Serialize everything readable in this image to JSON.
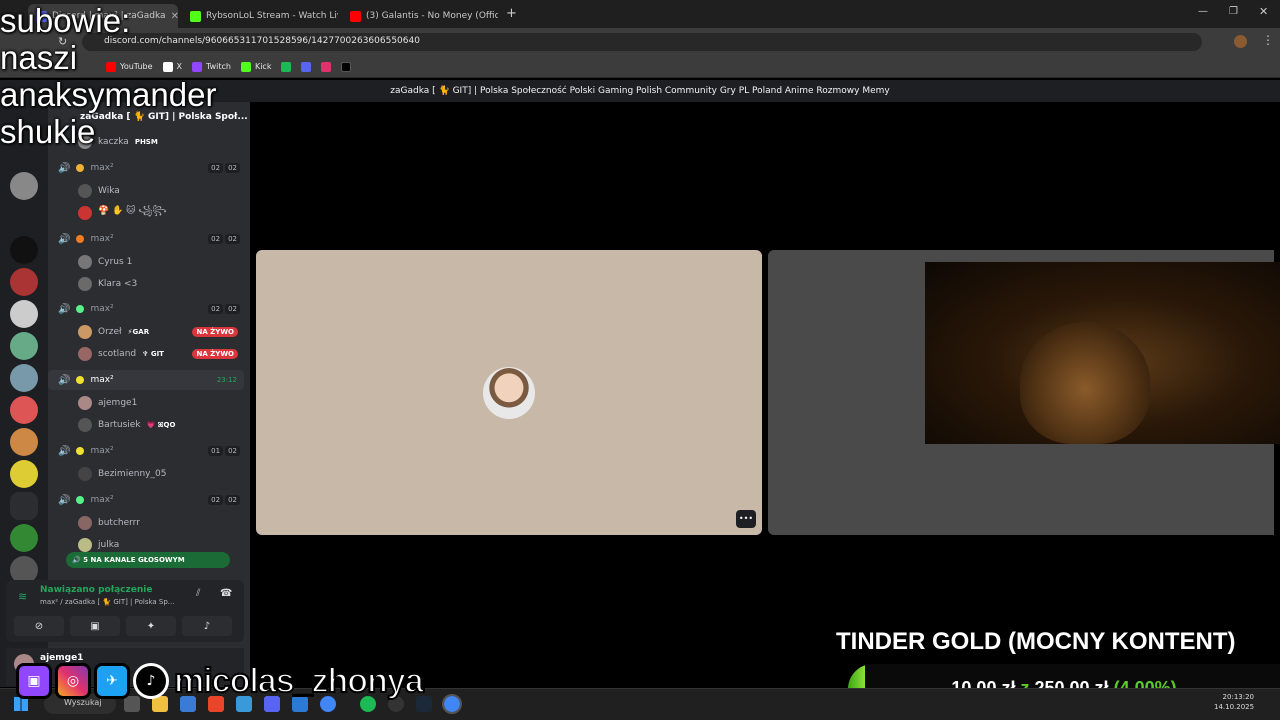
{
  "browser": {
    "tabs": [
      {
        "label": "Discord | max² | zaGadka",
        "color": "#5865f2"
      },
      {
        "label": "RybsonLoL Stream - Watch Live",
        "color": "#53fc18"
      },
      {
        "label": "(3) Galantis - No Money (Offici...",
        "color": "#ff0000"
      }
    ],
    "new_tab": "+",
    "url": "discord.com/channels/960665311701528596/1427700263606550640",
    "bookmarks": [
      {
        "label": "YouTube",
        "color": "#ff0000"
      },
      {
        "label": "X",
        "color": "#ffffff"
      },
      {
        "label": "Twitch",
        "color": "#9146ff"
      },
      {
        "label": "Kick",
        "color": "#53fc18"
      }
    ]
  },
  "discord": {
    "server_title": "zaGadka [ 🐈 GIT] | Polska Społeczność Polski Gaming Polish Community Gry PL Poland Anime Rozmowy Memy",
    "server_header": "zaGadka [ 🐈 GIT] | Polska Społ...",
    "channels": [
      {
        "type": "user",
        "name": "kaczka",
        "tag": "PHSM",
        "avatar": "#8a8a8a"
      },
      {
        "type": "voice",
        "name": "max²",
        "counts": [
          "02",
          "02"
        ],
        "dot": "#f0b232"
      },
      {
        "type": "user",
        "name": "Wika",
        "avatar": "#555"
      },
      {
        "type": "user",
        "name": "🍄 ✋ 🐱 ꧁꧂",
        "avatar": "#c33"
      },
      {
        "type": "voice",
        "name": "max²",
        "counts": [
          "02",
          "02"
        ],
        "dot": "#f47b20"
      },
      {
        "type": "user",
        "name": "Cyrus 1",
        "avatar": "#777"
      },
      {
        "type": "user",
        "name": "Klara <3",
        "avatar": "#6a6a6a"
      },
      {
        "type": "voice",
        "name": "max²",
        "counts": [
          "02",
          "02"
        ],
        "dot": "#57f287"
      },
      {
        "type": "user",
        "name": "Orzeł",
        "tag": "⚡GAR",
        "avatar": "#c96",
        "live": "NA ŻYWO"
      },
      {
        "type": "user",
        "name": "scotland",
        "tag": "♆ GIT",
        "avatar": "#966",
        "live": "NA ŻYWO"
      },
      {
        "type": "voice",
        "name": "max²",
        "counts": [
          "23:12"
        ],
        "dot": "#f0e030",
        "active": true
      },
      {
        "type": "user",
        "name": "ajemge1",
        "avatar": "#a88"
      },
      {
        "type": "user",
        "name": "Bartusiek",
        "tag": "💗 ꕤQO",
        "avatar": "#555"
      },
      {
        "type": "voice",
        "name": "max²",
        "counts": [
          "01",
          "02"
        ],
        "dot": "#f0e030"
      },
      {
        "type": "user",
        "name": "Bezimienny_05",
        "avatar": "#444"
      },
      {
        "type": "voice",
        "name": "max²",
        "counts": [
          "02",
          "02"
        ],
        "dot": "#57f287"
      },
      {
        "type": "user",
        "name": "butcherrr",
        "avatar": "#866"
      },
      {
        "type": "user",
        "name": "julka",
        "avatar": "#bb8"
      }
    ],
    "voice_banner": "5 NA KANALE GŁOSOWYM",
    "connection": {
      "status": "Nawiązano połączenie",
      "channel": "max² / zaGadka [ 🐈 GIT] | Polska Sp..."
    },
    "user": {
      "name": "ajemge1"
    },
    "more_label": "•••"
  },
  "overlay": {
    "subs_lines": [
      "subowie:",
      "naszi",
      "anaksymander",
      "shukie"
    ],
    "handle": "micolas_zhonya",
    "goal_title": "TINDER GOLD (MOCNY KONTENT)",
    "goal_current": "10,00 zł",
    "goal_sep": "z",
    "goal_target": "250,00 zł",
    "goal_percent": "(4.00%)",
    "goal_fraction": 0.04
  },
  "taskbar": {
    "search": "Wyszukaj",
    "time": "20:13:20",
    "date": "14.10.2025"
  }
}
